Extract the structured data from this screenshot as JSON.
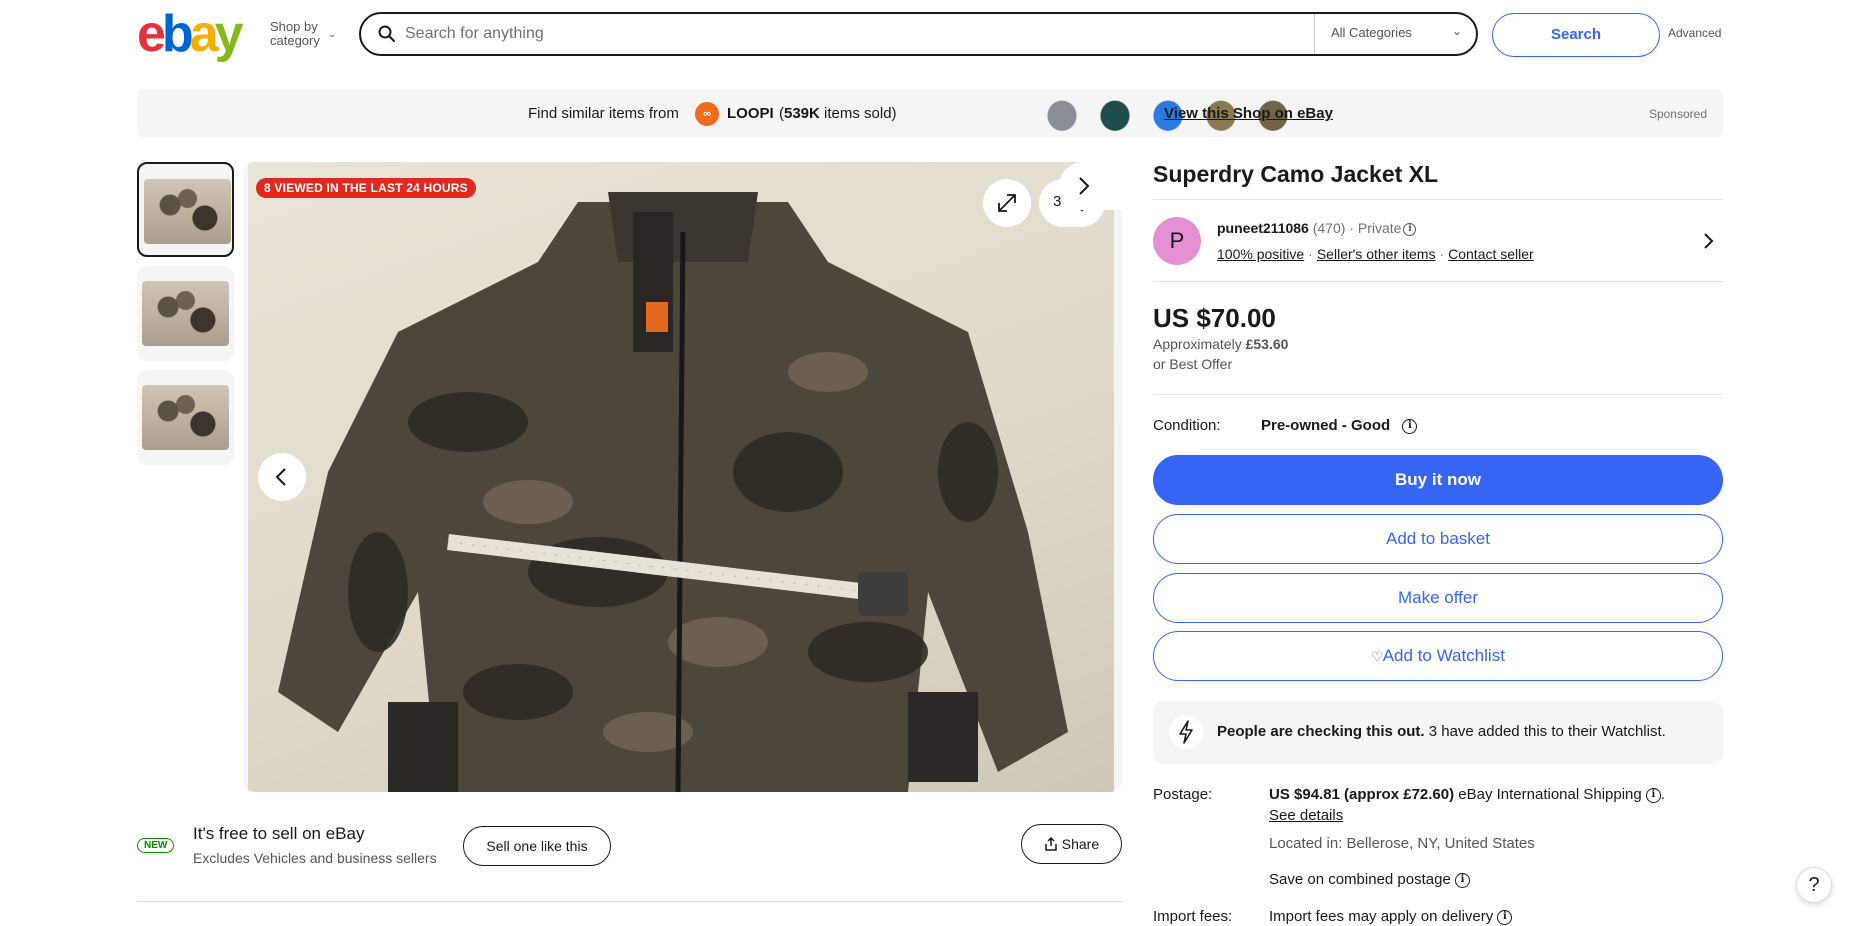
{
  "header": {
    "logo_letters": [
      "e",
      "b",
      "a",
      "y"
    ],
    "shop_by_line1": "Shop by",
    "shop_by_line2": "category",
    "search_placeholder": "Search for anything",
    "category_select": "All Categories",
    "search_button": "Search",
    "advanced_link": "Advanced"
  },
  "banner": {
    "find_text": "Find similar items from",
    "shop_logo_text": "∞",
    "shop_name": "LOOPI",
    "sold_text_prefix": "(",
    "sold_count": "539K",
    "sold_text_suffix": " items sold)",
    "thumb_colors": [
      "#8a8d96",
      "#1f4e4a",
      "#2b7be0",
      "#8a7a52",
      "#6f6446"
    ],
    "view_shop": "View this Shop on eBay",
    "sponsored": "Sponsored"
  },
  "gallery": {
    "viewed_badge": "8 VIEWED IN THE LAST 24 HOURS",
    "watch_count": "3",
    "thumbnail_count": 3,
    "active_thumbnail": 1
  },
  "sell_promo": {
    "new_badge": "NEW",
    "title": "It's free to sell on eBay",
    "subtitle": "Excludes Vehicles and business sellers",
    "sell_button": "Sell one like this"
  },
  "share_button": "Share",
  "listing": {
    "title": "Superdry Camo Jacket XL",
    "seller": {
      "avatar_letter": "P",
      "name": "puneet211086",
      "feedback_count": "(470)",
      "separator": "·",
      "type": "Private",
      "positive": "100% positive",
      "other_items": "Seller's other items",
      "contact": "Contact seller"
    },
    "price": "US $70.00",
    "approx_label": "Approximately",
    "approx_value": "£53.60",
    "best_offer": "or Best Offer",
    "condition_label": "Condition:",
    "condition_value": "Pre-owned - Good",
    "buy_now": "Buy it now",
    "add_basket": "Add to basket",
    "make_offer": "Make offer",
    "add_watchlist": "Add to Watchlist",
    "checking_bold": "People are checking this out.",
    "checking_rest": " 3 have added this to their Watchlist.",
    "postage_label": "Postage:",
    "postage_value": "US $94.81 (approx £72.60)",
    "postage_service": " eBay International Shipping",
    "see_details": "See details",
    "located": "Located in: Bellerose, NY, United States",
    "combined_postage": "Save on combined postage",
    "import_label": "Import fees:",
    "import_value": "Import fees may apply on delivery"
  },
  "help_button": "?"
}
